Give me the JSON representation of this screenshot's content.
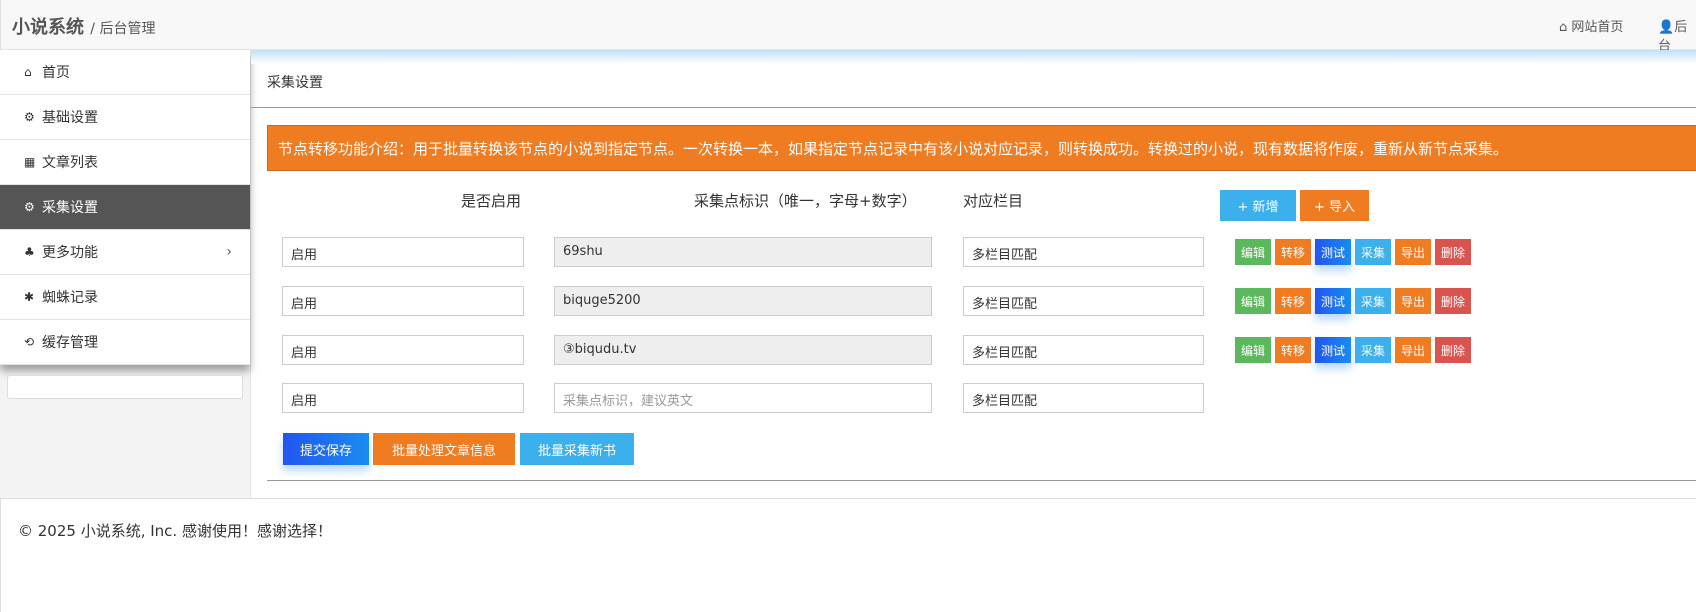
{
  "header": {
    "brand": "小说系统",
    "sub": "/ 后台管理",
    "links": [
      {
        "label": "网站首页",
        "icon": "home-icon"
      },
      {
        "label": "后台",
        "icon": "user-icon"
      }
    ]
  },
  "sidebar": {
    "items": [
      {
        "label": "首页",
        "icon": "home-icon"
      },
      {
        "label": "基础设置",
        "icon": "gear-icon"
      },
      {
        "label": "文章列表",
        "icon": "table-icon"
      },
      {
        "label": "采集设置",
        "icon": "gears-icon",
        "active": true
      },
      {
        "label": "更多功能",
        "icon": "sitemap-icon"
      },
      {
        "label": "蜘蛛记录",
        "icon": "bug-icon"
      },
      {
        "label": "缓存管理",
        "icon": "refresh-icon"
      }
    ]
  },
  "main": {
    "title": "采集设置",
    "alert": "节点转移功能介绍：用于批量转换该节点的小说到指定节点。一次转换一本，如果指定节点记录中有该小说对应记录，则转换成功。转换过的小说，现有数据将作废，重新从新节点采集。",
    "columns": [
      "是否启用",
      "采集点标识（唯一，字母+数字）",
      "对应栏目"
    ],
    "add_label": "+ 新增",
    "import_label": "+ 导入",
    "rows": [
      {
        "enabled": "启用",
        "id": "69shu",
        "column": "多栏目匹配"
      },
      {
        "enabled": "启用",
        "id": "biquge5200",
        "column": "多栏目匹配"
      },
      {
        "enabled": "启用",
        "id": "③biqudu.tv",
        "column": "多栏目匹配"
      }
    ],
    "new_row": {
      "enabled": "启用",
      "id_placeholder": "采集点标识，建议英文",
      "column": "多栏目匹配"
    },
    "actions": [
      "编辑",
      "转移",
      "测试",
      "采集",
      "导出",
      "删除"
    ],
    "save_label": "提交保存",
    "batch_label": "批量处理文章信息",
    "collect_label": "批量采集新书"
  },
  "footer": {
    "text": "© 2025 小说系统, Inc. 感谢使用！感谢选择！"
  }
}
